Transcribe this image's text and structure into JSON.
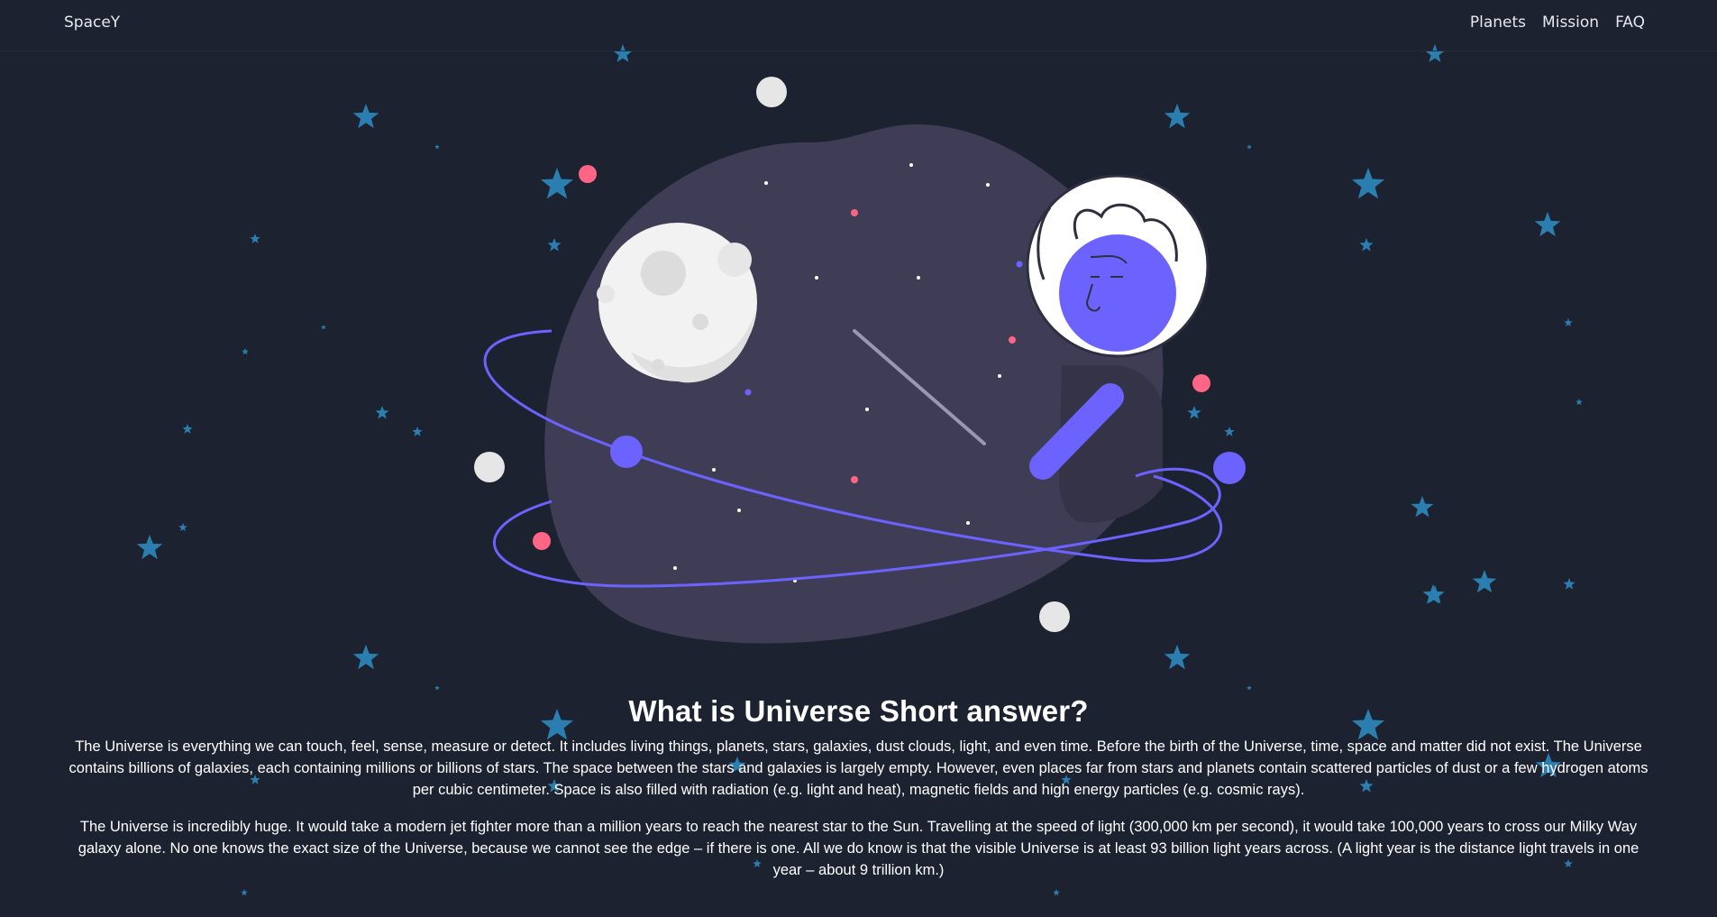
{
  "nav": {
    "brand": "SpaceY",
    "links": [
      "Planets",
      "Mission",
      "FAQ"
    ]
  },
  "hero": {
    "illustration": "astronaut-universe-illustration",
    "colors": {
      "background": "#1c2230",
      "blob": "#3f3d56",
      "accent_purple": "#6c63ff",
      "accent_pink": "#ff6584",
      "star_blue": "#2b7fb0",
      "moon": "#f2f2f2"
    }
  },
  "article": {
    "heading": "What is Universe Short answer?",
    "paragraphs": [
      "The Universe is everything we can touch, feel, sense, measure or detect. It includes living things, planets, stars, galaxies, dust clouds, light, and even time. Before the birth of the Universe, time, space and matter did not exist. The Universe contains billions of galaxies, each containing millions or billions of stars. The space between the stars and galaxies is largely empty. However, even places far from stars and planets contain scattered particles of dust or a few hydrogen atoms per cubic centimeter. Space is also filled with radiation (e.g. light and heat), magnetic fields and high energy particles (e.g. cosmic rays).",
      "The Universe is incredibly huge. It would take a modern jet fighter more than a million years to reach the nearest star to the Sun. Travelling at the speed of light (300,000 km per second), it would take 100,000 years to cross our Milky Way galaxy alone. No one knows the exact size of the Universe, because we cannot see the edge – if there is one. All we do know is that the visible Universe is at least 93 billion light years across. (A light year is the distance light travels in one year – about 9 trillion km.)"
    ]
  }
}
